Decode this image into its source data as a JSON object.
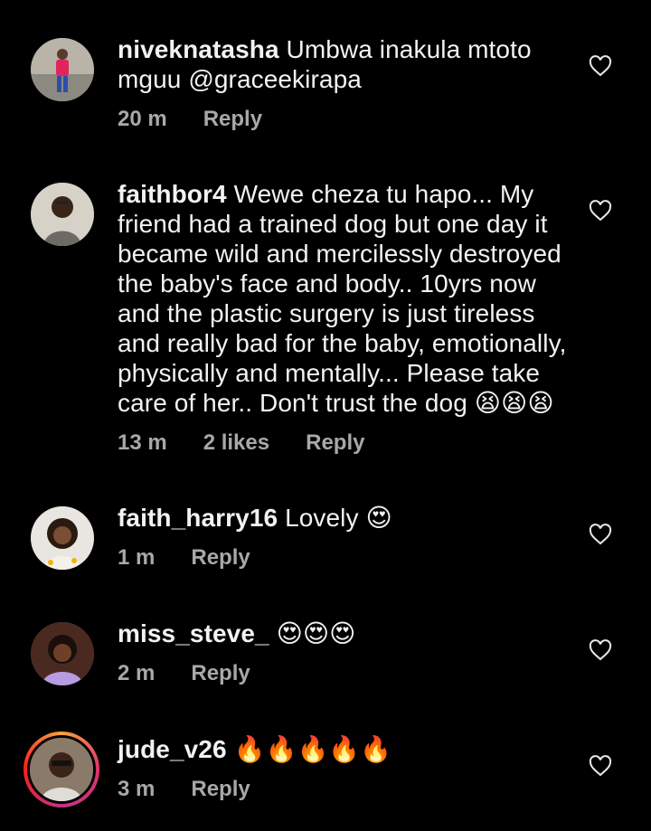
{
  "comments": [
    {
      "username": "niveknatasha",
      "text": "Umbwa inakula mtoto mguu @graceekirapa",
      "time": "20 m",
      "likes": "",
      "reply": "Reply"
    },
    {
      "username": "faithbor4",
      "text": "Wewe cheza tu hapo... My friend had a trained dog but one day it became wild and mercilessly destroyed the baby's face and body.. 10yrs now and the plastic surgery is just tireless and really bad for the baby, emotionally, physically and mentally... Please take care of her.. Don't trust the dog 😫😫😫",
      "time": "13 m",
      "likes": "2 likes",
      "reply": "Reply"
    },
    {
      "username": "faith_harry16",
      "text": "Lovely 😍",
      "time": "1 m",
      "likes": "",
      "reply": "Reply"
    },
    {
      "username": "miss_steve_",
      "text": "😍😍😍",
      "time": "2 m",
      "likes": "",
      "reply": "Reply"
    },
    {
      "username": "jude_v26",
      "text": "🔥🔥🔥🔥🔥",
      "time": "3 m",
      "likes": "",
      "reply": "Reply"
    }
  ],
  "icons": {
    "like": "heart-outline-icon"
  },
  "colors": {
    "background": "#000000",
    "text": "#f2f2f2",
    "meta": "#a8a8a8"
  }
}
